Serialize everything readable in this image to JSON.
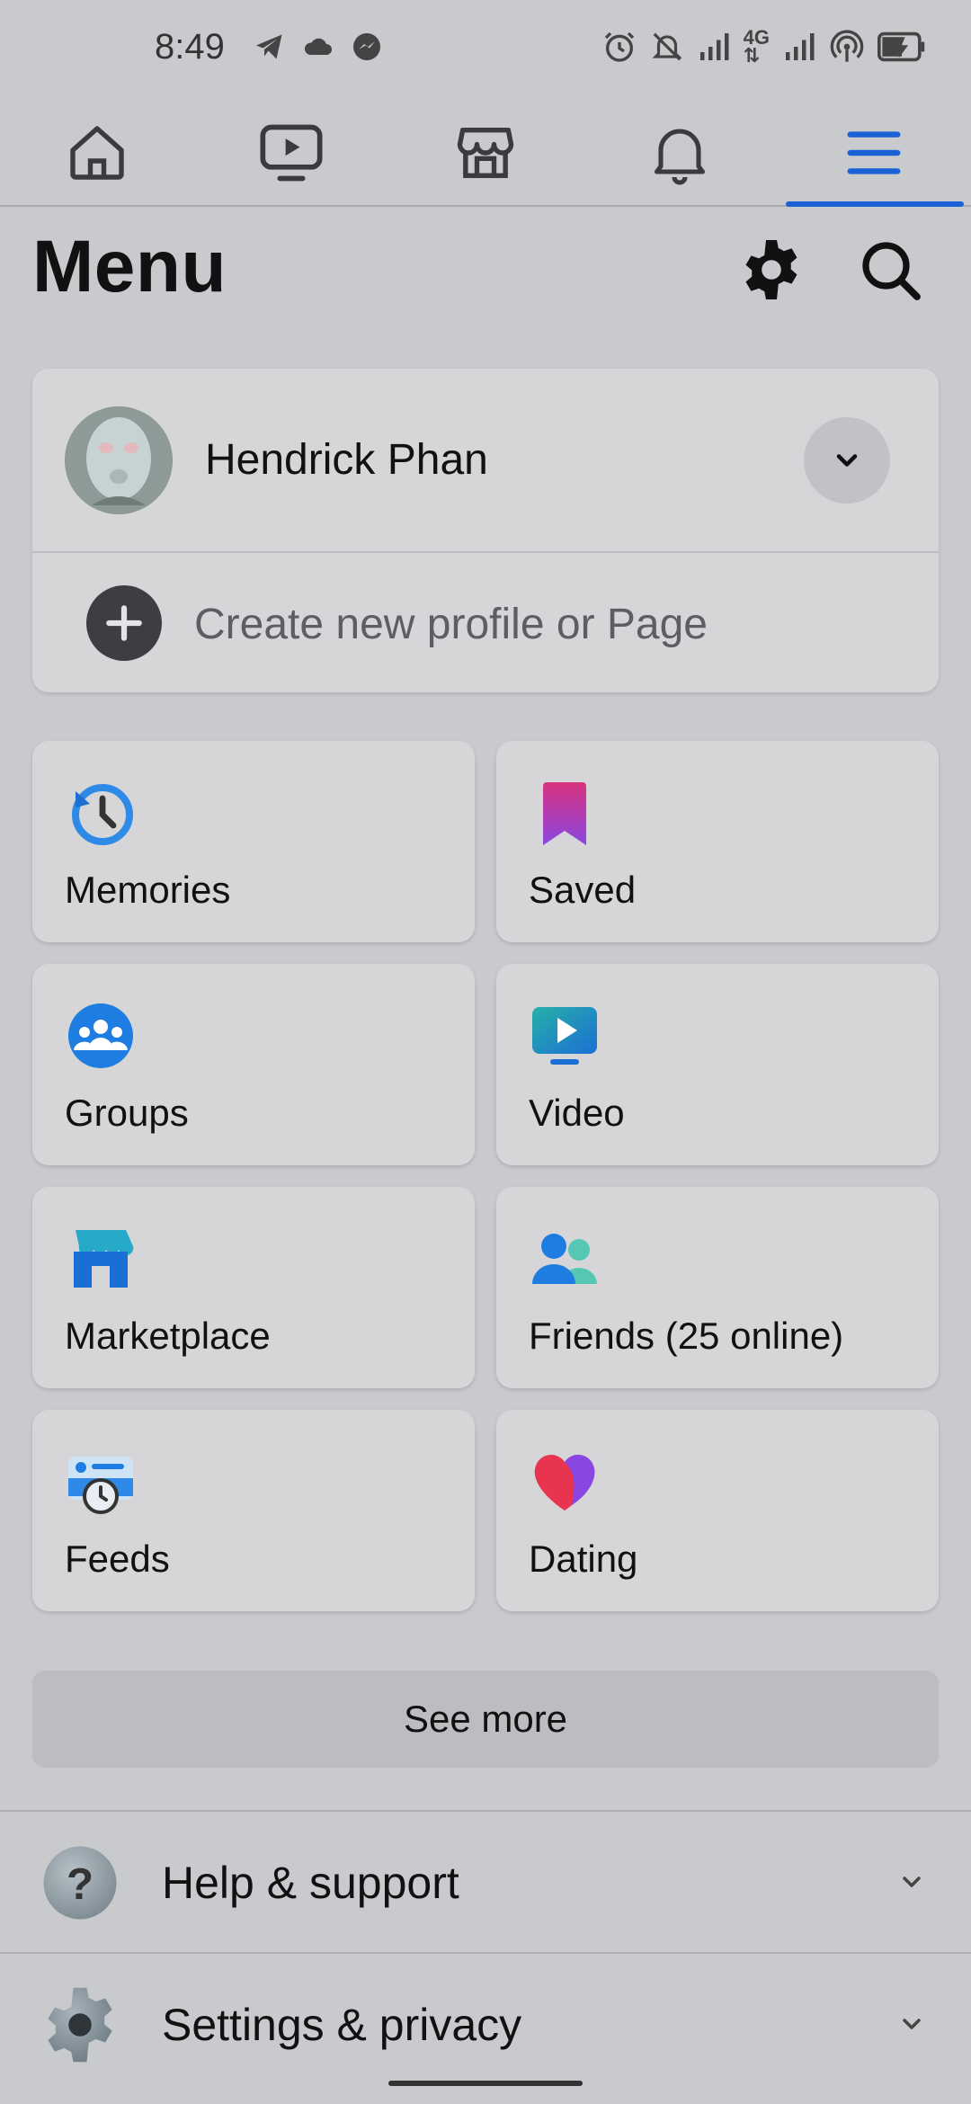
{
  "status_bar": {
    "time": "8:49",
    "left_icons": [
      "telegram-icon",
      "cloud-icon",
      "messenger-icon"
    ],
    "right_icons": [
      "alarm-icon",
      "bell-off-icon",
      "signal-icon",
      "4g-icon",
      "signal-icon",
      "hotspot-icon",
      "battery-charging-icon"
    ]
  },
  "top_nav": {
    "tabs": [
      {
        "name": "home",
        "icon": "home-icon"
      },
      {
        "name": "video",
        "icon": "video-icon"
      },
      {
        "name": "marketplace",
        "icon": "marketplace-icon"
      },
      {
        "name": "notifications",
        "icon": "bell-icon"
      },
      {
        "name": "menu",
        "icon": "menu-icon",
        "active": true
      }
    ],
    "active_color": "#1b61d6"
  },
  "header": {
    "title": "Menu",
    "actions": [
      "settings-gear-icon",
      "search-icon"
    ]
  },
  "profile": {
    "name": "Hendrick Phan",
    "create_label": "Create new profile or Page"
  },
  "shortcuts": [
    {
      "label": "Memories",
      "icon": "memories-clock-icon"
    },
    {
      "label": "Saved",
      "icon": "saved-bookmark-icon"
    },
    {
      "label": "Groups",
      "icon": "groups-icon"
    },
    {
      "label": "Video",
      "icon": "video-tv-icon"
    },
    {
      "label": "Marketplace",
      "icon": "marketplace-store-icon"
    },
    {
      "label": "Friends (25 online)",
      "icon": "friends-icon"
    },
    {
      "label": "Feeds",
      "icon": "feeds-icon"
    },
    {
      "label": "Dating",
      "icon": "dating-heart-icon"
    }
  ],
  "see_more_label": "See more",
  "sections": [
    {
      "label": "Help & support",
      "icon": "help-question-icon"
    },
    {
      "label": "Settings & privacy",
      "icon": "settings-gear-icon"
    }
  ]
}
